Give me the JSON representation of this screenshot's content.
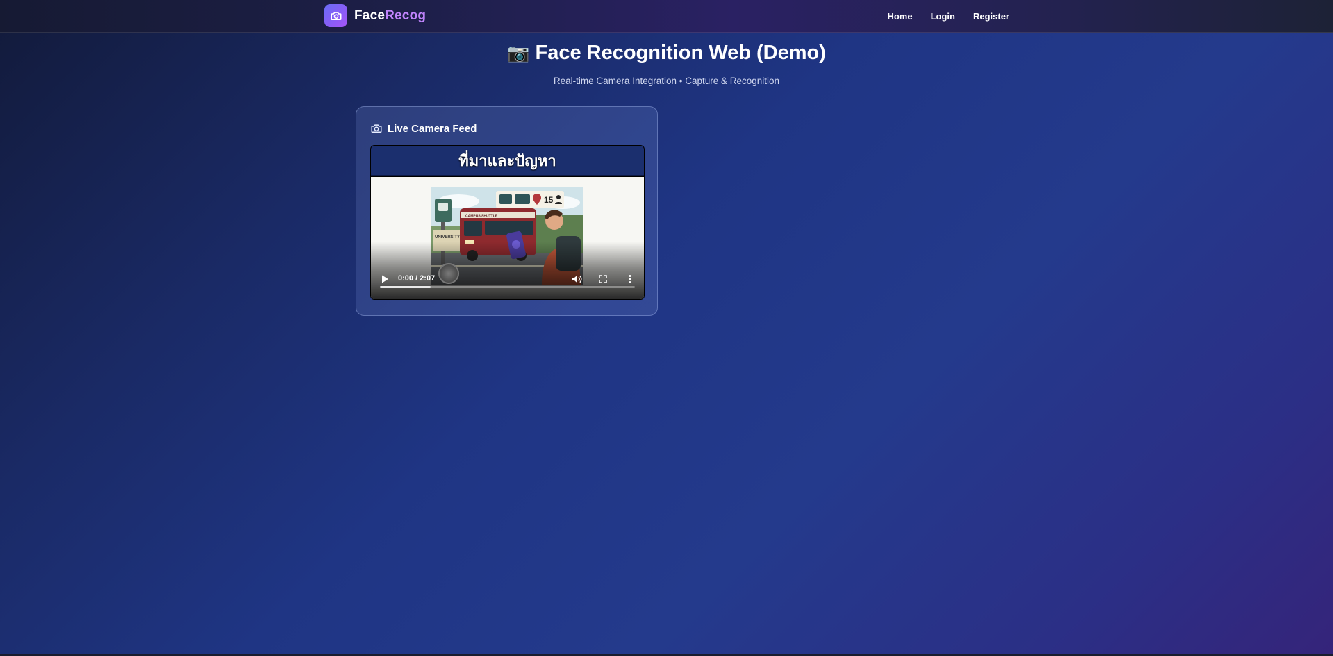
{
  "brand": {
    "name_part1": "Face",
    "name_part2": "Recog",
    "logo_icon": "camera-icon"
  },
  "nav": {
    "links": [
      {
        "label": "Home"
      },
      {
        "label": "Login"
      },
      {
        "label": "Register"
      }
    ]
  },
  "hero": {
    "title_emoji": "📷",
    "title": "Face Recognition Web (Demo)",
    "subtitle": "Real-time Camera Integration • Capture & Recognition"
  },
  "camera_card": {
    "title": "Live Camera Feed",
    "title_icon": "camera-icon",
    "video": {
      "slide_heading": "ที่มาและปัญหา",
      "illustration_texts": {
        "bus_sign": "CAMPUS SHUTTLE",
        "university": "UNIVERSITY OF PHUKET",
        "count": "15"
      },
      "current_time": "0:00",
      "duration": "2:07",
      "time_display": "0:00 / 2:07",
      "progress_fraction": 0.2,
      "controls": [
        "play-icon",
        "volume-icon",
        "fullscreen-icon",
        "more-options-icon"
      ]
    }
  },
  "colors": {
    "brand_accent": "#c084fc",
    "logo_gradient_start": "#6a6cf6",
    "logo_gradient_end": "#a855f7",
    "slide_header": "#1b2f6e"
  }
}
